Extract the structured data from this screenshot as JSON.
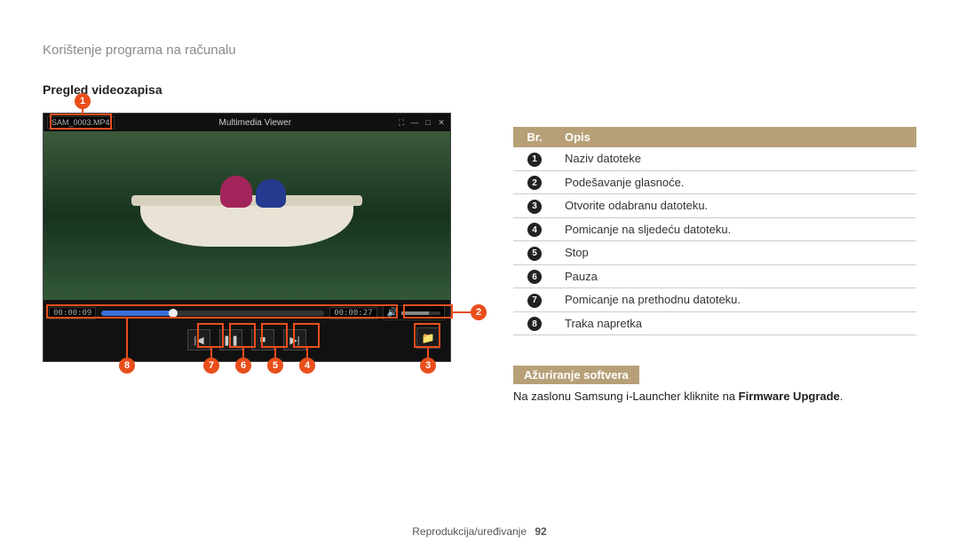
{
  "breadcrumb": "Korištenje programa na računalu",
  "section_title": "Pregled videozapisa",
  "player": {
    "filename": "SAM_0003.MP4",
    "app_title": "Multimedia Viewer",
    "time_current": "00:00:09",
    "time_total": "00:00:27"
  },
  "callouts": {
    "c1": "1",
    "c2": "2",
    "c3": "3",
    "c4": "4",
    "c5": "5",
    "c6": "6",
    "c7": "7",
    "c8": "8"
  },
  "table": {
    "head_num": "Br.",
    "head_desc": "Opis",
    "rows": [
      {
        "n": "1",
        "d": "Naziv datoteke"
      },
      {
        "n": "2",
        "d": "Podešavanje glasnoće."
      },
      {
        "n": "3",
        "d": "Otvorite odabranu datoteku."
      },
      {
        "n": "4",
        "d": "Pomicanje na sljedeću datoteku."
      },
      {
        "n": "5",
        "d": "Stop"
      },
      {
        "n": "6",
        "d": "Pauza"
      },
      {
        "n": "7",
        "d": "Pomicanje na prethodnu datoteku."
      },
      {
        "n": "8",
        "d": "Traka napretka"
      }
    ]
  },
  "update": {
    "heading": "Ažuriranje softvera",
    "text_prefix": "Na zaslonu Samsung i-Launcher kliknite na ",
    "text_bold": "Firmware Upgrade",
    "text_suffix": "."
  },
  "footer": {
    "section": "Reprodukcija/uređivanje",
    "page": "92"
  }
}
